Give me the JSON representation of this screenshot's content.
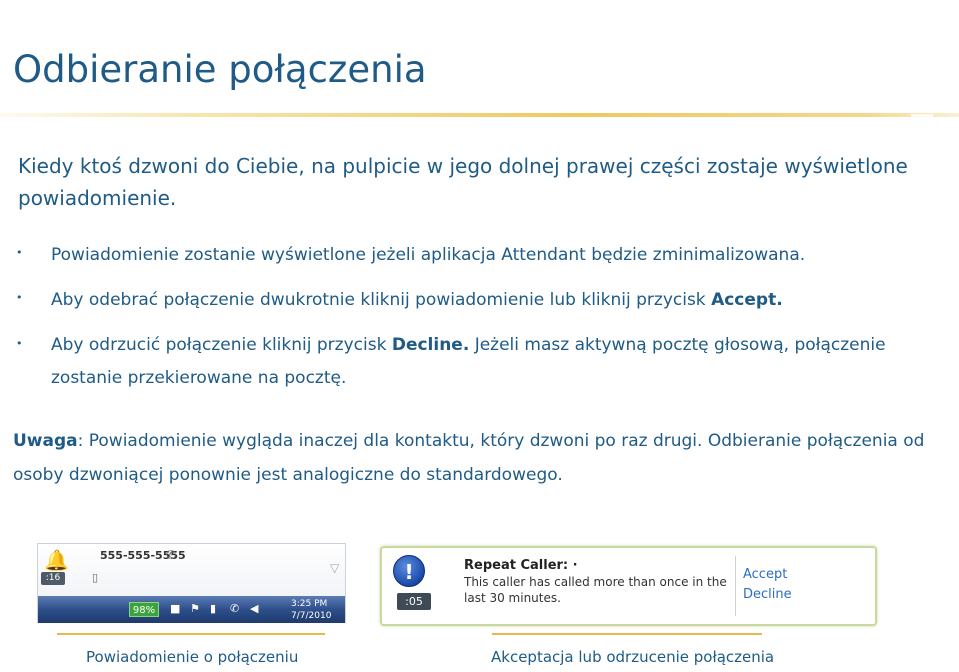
{
  "title": "Odbieranie połączenia",
  "intro": "Kiedy ktoś dzwoni do Ciebie, na pulpicie w jego dolnej prawej części zostaje wyświetlone powiadomienie.",
  "bullet_glyph": "•",
  "bullets": [
    {
      "text": "Powiadomienie zostanie wyświetlone jeżeli aplikacja Attendant będzie zminimalizowana.",
      "bold": ""
    },
    {
      "text": "Aby odebrać połączenie dwukrotnie kliknij powiadomienie lub kliknij przycisk ",
      "bold": "Accept."
    },
    {
      "text": "Aby odrzucić połączenie kliknij przycisk ",
      "bold": "Decline.",
      "after": " Jeżeli masz aktywną pocztę głosową, połączenie zostanie przekierowane na pocztę."
    }
  ],
  "note": {
    "label": "Uwaga",
    "text": ": Powiadomienie wygląda inaczej dla kontaktu, który dzwoni po raz drugi. Odbieranie połączenia od osoby dzwoniącej ponownie jest analogiczne do standardowego."
  },
  "tray_notification": {
    "number": "555-555-5555",
    "timer": ":16",
    "battery": "98%",
    "clock_time": "3:25 PM",
    "clock_date": "7/7/2010",
    "icons": [
      "bell-icon",
      "phone-icon",
      "document-icon",
      "close-icon",
      "plug-icon",
      "flag-icon",
      "battery-icon",
      "phone-off-icon",
      "volume-icon"
    ]
  },
  "repeat_caller": {
    "title": "Repeat Caller:",
    "title_suffix": " ·",
    "body": "This caller has called more than once in the last 30 minutes.",
    "timer": ":05",
    "accept": "Accept",
    "decline": "Decline",
    "icon": "exclamation-icon"
  },
  "captions": {
    "left": "Powiadomienie o połączeniu",
    "right": "Akceptacja lub odrzucenie połączenia"
  },
  "colors": {
    "heading": "#1f5b86",
    "accent_rule": "#f0c860",
    "link": "#2b6cc4",
    "battery": "#3ca43c"
  }
}
